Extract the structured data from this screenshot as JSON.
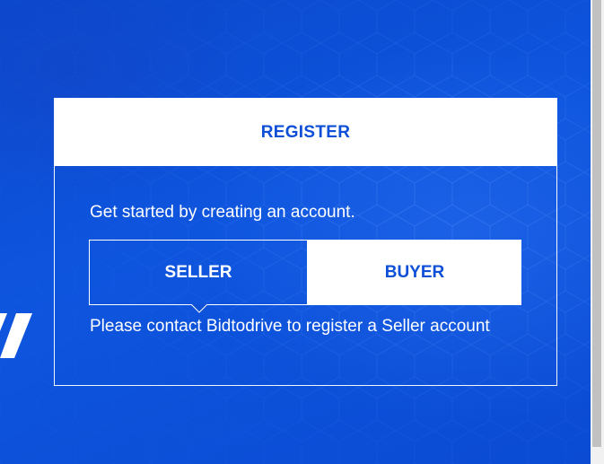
{
  "colors": {
    "background": "#0d4fd6",
    "panel_header_bg": "#ffffff",
    "accent_text": "#0d4fd6",
    "text": "#ffffff",
    "scrollbar_thumb": "#c1c1c1"
  },
  "register": {
    "title": "REGISTER",
    "intro": "Get started by creating an account.",
    "account_types": [
      {
        "label": "SELLER",
        "selected": true
      },
      {
        "label": "BUYER",
        "selected": false
      }
    ],
    "notice": "Please contact Bidtodrive to register a Seller account"
  },
  "icons": {
    "logo_fragment": "logo-slash-icon",
    "selection_pointer": "caret-down-icon"
  }
}
